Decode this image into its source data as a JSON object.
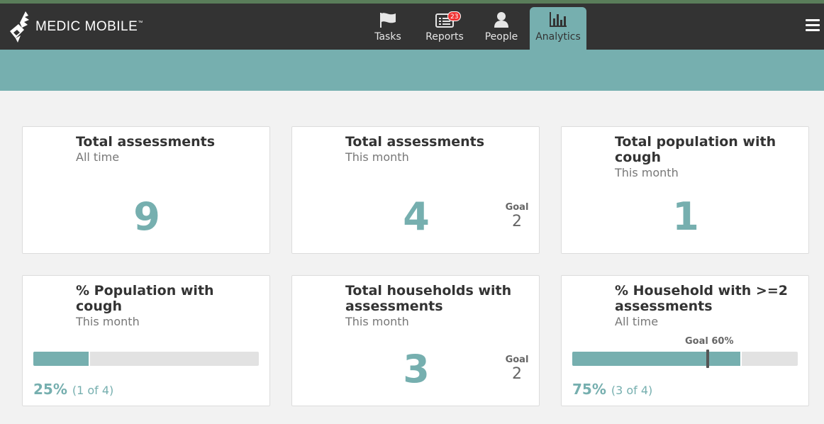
{
  "brand": {
    "name": "MEDIC MOBILE",
    "tm": "™"
  },
  "nav": {
    "tabs": [
      {
        "label": "Tasks",
        "icon": "flag-icon",
        "active": false
      },
      {
        "label": "Reports",
        "icon": "reports-icon",
        "badge": "23",
        "active": false
      },
      {
        "label": "People",
        "icon": "person-icon",
        "active": false
      },
      {
        "label": "Analytics",
        "icon": "bar-chart-icon",
        "active": true
      }
    ],
    "menu_icon": "hamburger-menu-icon"
  },
  "colors": {
    "accent": "#76afaf",
    "navbar": "#333333",
    "badge": "#ee3333"
  },
  "cards": [
    {
      "title": "Total assessments",
      "subtitle": "All time",
      "value": "9"
    },
    {
      "title": "Total assessments",
      "subtitle": "This month",
      "value": "4",
      "goal_label": "Goal",
      "goal_value": "2"
    },
    {
      "title": "Total population with cough",
      "subtitle": "This month",
      "value": "1"
    },
    {
      "title": "% Population with cough",
      "subtitle": "This month",
      "percent": "25%",
      "count": "(1 of 4)",
      "progress": 0.25
    },
    {
      "title": "Total households with assessments",
      "subtitle": "This month",
      "value": "3",
      "goal_label": "Goal",
      "goal_value": "2"
    },
    {
      "title": "% Household with >=2 assessments",
      "subtitle": "All time",
      "percent": "75%",
      "count": "(3 of 4)",
      "progress": 0.75,
      "goal_text": "Goal 60%",
      "goal": 0.6
    }
  ]
}
